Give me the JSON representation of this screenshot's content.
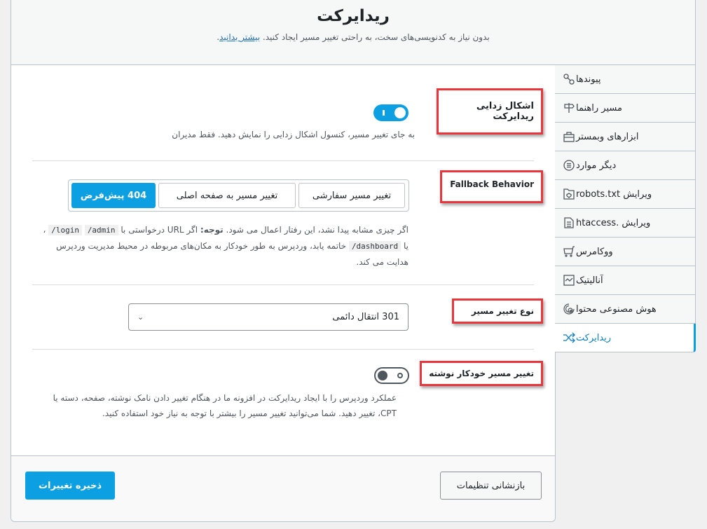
{
  "header": {
    "title": "ریدایرکت",
    "description": "بدون نیاز به کدنویسی‌های سخت، به راحتی تغییر مسیر ایجاد کنید.",
    "learn_more": "بیشتر بدانید"
  },
  "sidebar": {
    "items": [
      {
        "label": "پیوندها",
        "icon": "link-icon"
      },
      {
        "label": "مسیر راهنما",
        "icon": "signpost-icon"
      },
      {
        "label": "ابزارهای وبمستر",
        "icon": "toolbox-icon"
      },
      {
        "label": "دیگر موارد",
        "icon": "list-circle-icon"
      },
      {
        "label": "ویرایش robots.txt",
        "icon": "robots-file-icon"
      },
      {
        "label": "ویرایش .htaccess",
        "icon": "htaccess-file-icon"
      },
      {
        "label": "ووکامرس",
        "icon": "cart-icon"
      },
      {
        "label": "آنالیتیک",
        "icon": "analytics-icon"
      },
      {
        "label": "هوش مصنوعی محتوا",
        "icon": "ai-fingerprint-icon"
      },
      {
        "label": "ریدایرکت",
        "icon": "shuffle-icon",
        "active": true
      }
    ]
  },
  "settings": {
    "debug": {
      "label": "اشکال زدایی ریدایرکت",
      "enabled": true,
      "help": "به جای تغییر مسیر، کنسول اشکال زدایی را نمایش دهید. فقط مدیران"
    },
    "fallback": {
      "label": "Fallback Behavior",
      "options": [
        "404 پیش‌فرض",
        "تغییر مسیر به صفحه اصلی",
        "تغییر مسیر سفارشی"
      ],
      "selected": "404 پیش‌فرض",
      "help_1": "اگر چیزی مشابه پیدا نشد، این رفتار اعمال می شود.",
      "help_note": "توجه:",
      "help_2": "اگر URL درخواستی با",
      "code_admin": "/admin",
      "code_login": "/login",
      "help_or": "، یا",
      "code_dashboard": "/dashboard",
      "help_3": "خاتمه یابد، وردپرس به طور خودکار به مکان‌های مربوطه در محیط مدیریت وردپرس هدایت می کند."
    },
    "redirect_type": {
      "label": "نوع تغییر مسیر",
      "value": "301 انتقال دائمی"
    },
    "auto_post_redirect": {
      "label": "تغییر مسیر خودکار نوشته",
      "enabled": false,
      "help": "عملکرد وردپرس را با ایجاد ریدایرکت در افزونه ما در هنگام تغییر دادن نامک نوشته، صفحه، دسته یا CPT، تغییر دهید. شما می‌توانید تغییر مسیر را بیشتر با توجه به نیاز خود استفاده کنید."
    }
  },
  "footer": {
    "save": "ذخیره تغییرات",
    "reset": "بازنشانی تنظیمات"
  },
  "colors": {
    "accent": "#0ca0e2",
    "highlight_border": "#e8363c"
  }
}
